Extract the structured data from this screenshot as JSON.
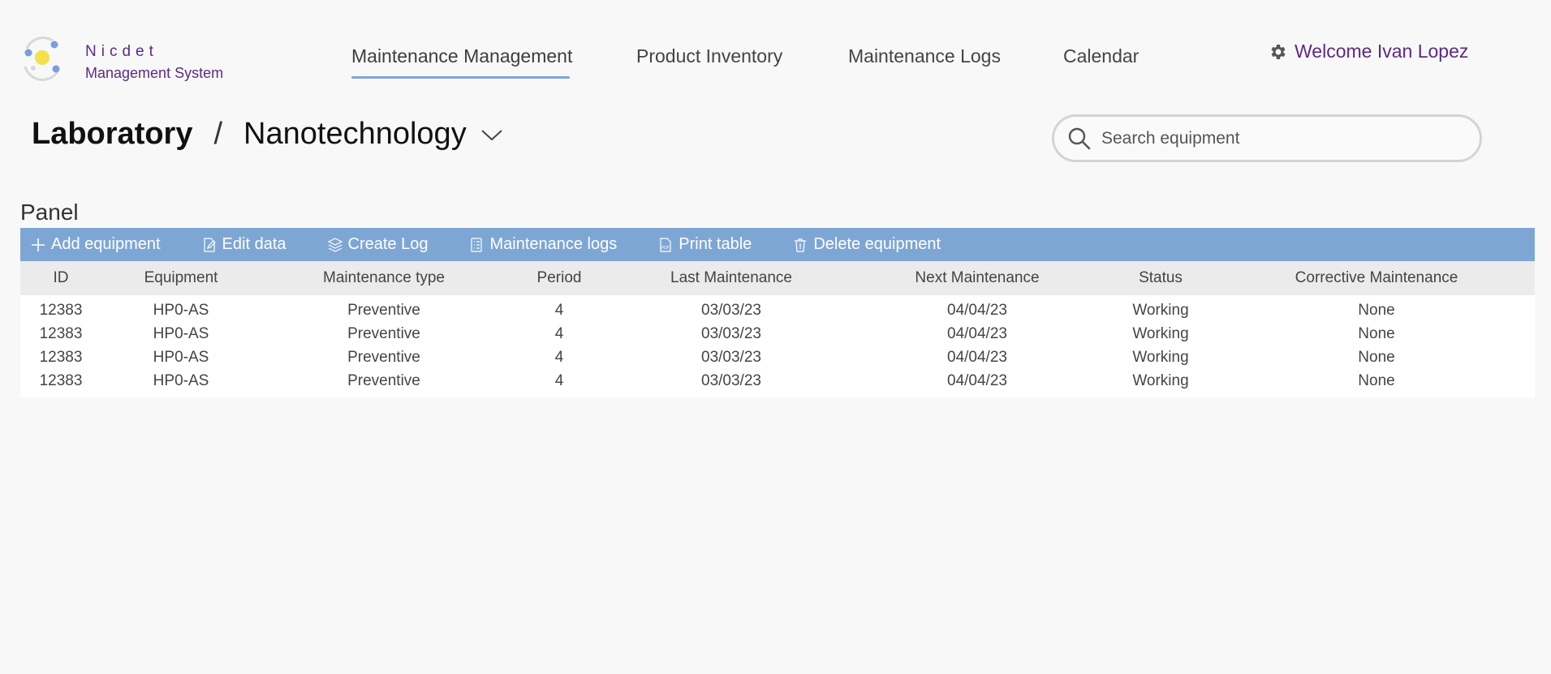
{
  "brand": {
    "name": "Nicdet",
    "subtitle": "Management System"
  },
  "nav": {
    "items": [
      {
        "label": "Maintenance Management",
        "active": true
      },
      {
        "label": "Product Inventory",
        "active": false
      },
      {
        "label": "Maintenance Logs",
        "active": false
      },
      {
        "label": "Calendar",
        "active": false
      }
    ]
  },
  "user": {
    "welcome": "Welcome Ivan Lopez",
    "icon": "gear-icon"
  },
  "breadcrumb": {
    "root": "Laboratory",
    "separator": "/",
    "current": "Nanotechnology"
  },
  "search": {
    "placeholder": "Search equipment",
    "value": ""
  },
  "panel": {
    "title": "Panel",
    "toolbar": [
      {
        "label": "Add equipment",
        "icon": "plus-icon"
      },
      {
        "label": "Edit data",
        "icon": "edit-icon"
      },
      {
        "label": "Create Log",
        "icon": "layers-icon"
      },
      {
        "label": "Maintenance logs",
        "icon": "list-icon"
      },
      {
        "label": "Print table",
        "icon": "pdf-icon"
      },
      {
        "label": "Delete equipment",
        "icon": "trash-icon"
      }
    ],
    "table": {
      "columns": [
        "ID",
        "Equipment",
        "Maintenance type",
        "Period",
        "Last Maintenance",
        "Next Maintenance",
        "Status",
        "Corrective Maintenance"
      ],
      "rows": [
        [
          "12383",
          "HP0-AS",
          "Preventive",
          "4",
          "03/03/23",
          "04/04/23",
          "Working",
          "None"
        ],
        [
          "12383",
          "HP0-AS",
          "Preventive",
          "4",
          "03/03/23",
          "04/04/23",
          "Working",
          "None"
        ],
        [
          "12383",
          "HP0-AS",
          "Preventive",
          "4",
          "03/03/23",
          "04/04/23",
          "Working",
          "None"
        ],
        [
          "12383",
          "HP0-AS",
          "Preventive",
          "4",
          "03/03/23",
          "04/04/23",
          "Working",
          "None"
        ]
      ]
    }
  },
  "colors": {
    "brand": "#5b2a86",
    "accent": "#7ea6d5",
    "background": "#f8f8f8"
  }
}
